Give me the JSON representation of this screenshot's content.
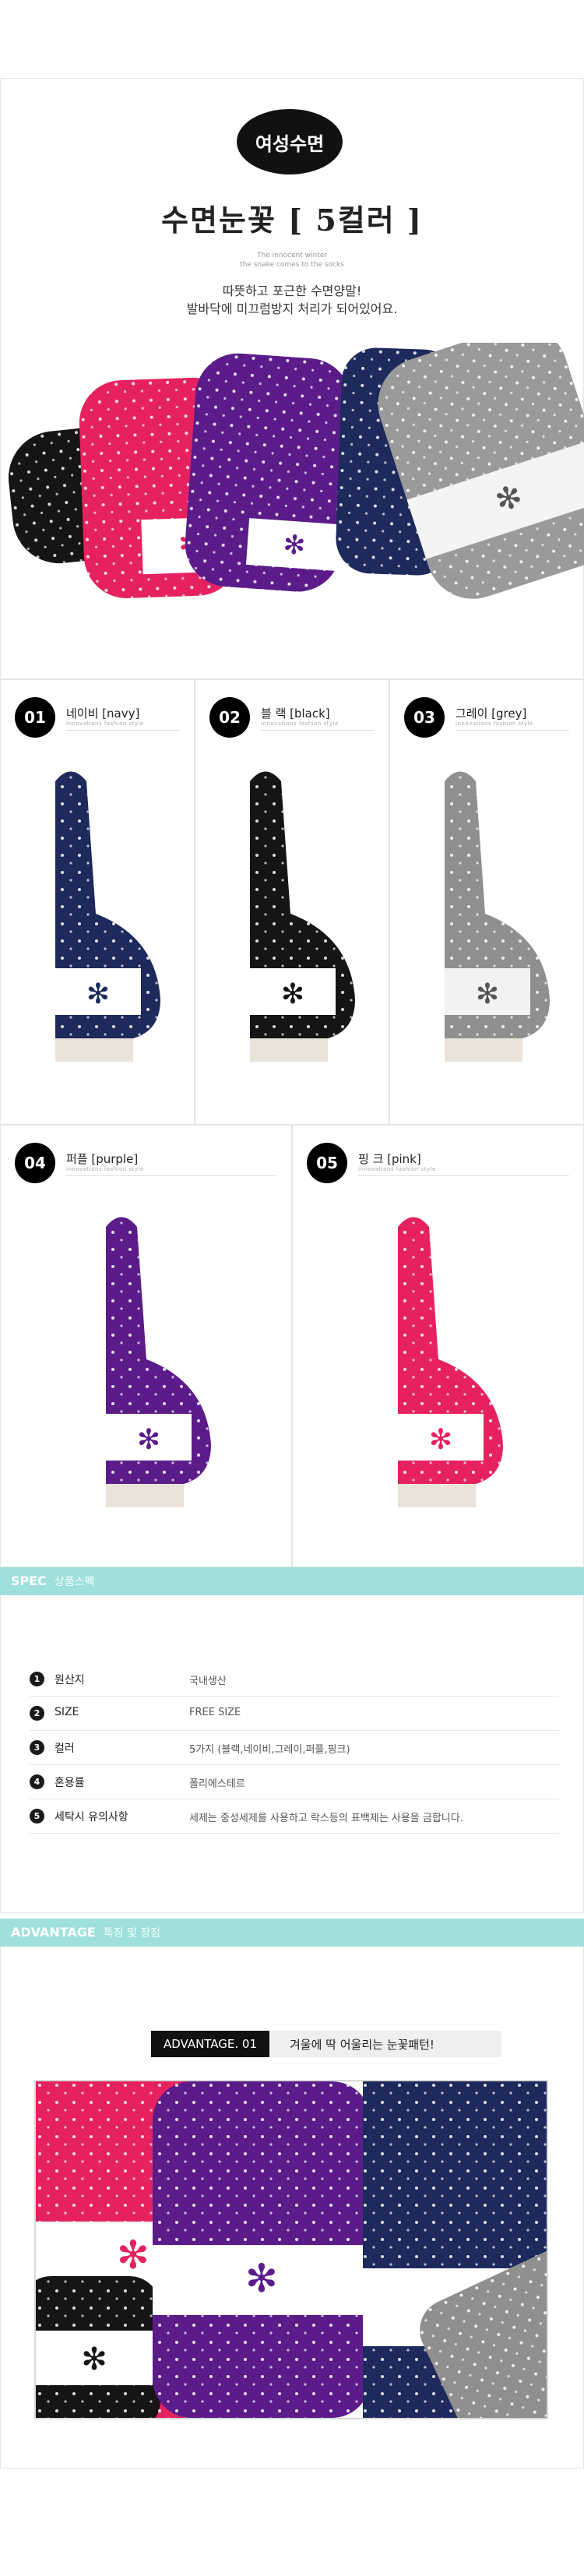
{
  "hero": {
    "badge": "여성수면",
    "title": "수면눈꽃 [ 5컬러 ]",
    "tagline": [
      "The innocent winter",
      "the snake comes to the socks"
    ],
    "desc": [
      "따뜻하고 포근한 수면양말!",
      "발바닥에 미끄럼방지 처리가 되어있어요."
    ]
  },
  "products": [
    {
      "num": "01",
      "name": "네이비 [navy]",
      "sub": "innovations fashion style",
      "color": "#1e2a5c"
    },
    {
      "num": "02",
      "name": "블 랙 [black]",
      "sub": "innovations fashion style",
      "color": "#151515"
    },
    {
      "num": "03",
      "name": "그레이 [grey]",
      "sub": "innovations fashion style",
      "color": "#8f8f8f"
    },
    {
      "num": "04",
      "name": "퍼플 [purple]",
      "sub": "innovations fashion style",
      "color": "#5b1c8a"
    },
    {
      "num": "05",
      "name": "핑 크 [pink]",
      "sub": "innovations fashion style",
      "color": "#e5225f"
    }
  ],
  "spec": {
    "bar_title": "SPEC",
    "bar_sub": "상품스펙",
    "rows": [
      {
        "num": "1",
        "label": "원산지",
        "value": "국내생산"
      },
      {
        "num": "2",
        "label": "SIZE",
        "value": "FREE SIZE"
      },
      {
        "num": "3",
        "label": "컬러",
        "value": "5가지 (블랙,네이비,그레이,퍼플,핑크)"
      },
      {
        "num": "4",
        "label": "혼용률",
        "value": "폴리에스테르"
      },
      {
        "num": "5",
        "label": "세탁시 유의사항",
        "value": "세제는 중성세제를 사용하고 락스등의 표백제는 사용을 금합니다."
      }
    ]
  },
  "advantage": {
    "bar_title": "ADVANTAGE",
    "bar_sub": "특징 및 장점",
    "tag": "ADVANTAGE. 01",
    "text": "겨울에 딱 어울리는 눈꽃패턴!"
  },
  "colors": {
    "accent_bar": "#9fe0dc",
    "navy": "#1e2a5c",
    "black": "#151515",
    "grey": "#8f8f8f",
    "purple": "#5b1c8a",
    "pink": "#e5225f"
  }
}
